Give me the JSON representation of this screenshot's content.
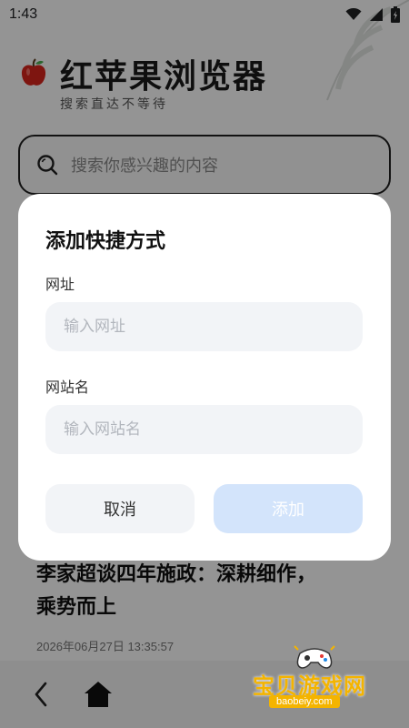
{
  "status_bar": {
    "time": "1:43",
    "icons": [
      "wifi-icon",
      "signal-icon",
      "battery-icon"
    ]
  },
  "brand": {
    "title": "红苹果浏览器",
    "slogan": "搜索直达不等待",
    "logo_icon": "apple-icon"
  },
  "search": {
    "placeholder": "搜索你感兴趣的内容",
    "icon": "search-icon"
  },
  "news": {
    "headline_line1": "李家超谈四年施政：深耕细作，",
    "headline_line2": "乘势而上",
    "timestamp": "2026年06月27日 13:35:57"
  },
  "bottom_nav": {
    "icons": [
      "back-arrow-icon",
      "home-icon"
    ]
  },
  "dialog": {
    "title": "添加快捷方式",
    "url_label": "网址",
    "url_placeholder": "输入网址",
    "name_label": "网站名",
    "name_placeholder": "输入网站名",
    "cancel_label": "取消",
    "add_label": "添加"
  },
  "watermark": {
    "text": "宝贝游戏网",
    "url": "baobeiy.com"
  },
  "colors": {
    "add_button_bg": "#d3e4fb",
    "input_bg": "#f2f4f7",
    "overlay": "rgba(0,0,0,0.42)",
    "watermark": "#f4b400"
  }
}
